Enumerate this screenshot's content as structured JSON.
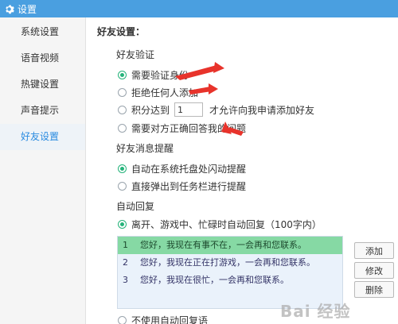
{
  "window": {
    "title": "设置",
    "accent_color": "#4a9fe0"
  },
  "sidebar": {
    "items": [
      {
        "label": "系统设置"
      },
      {
        "label": "语音视频"
      },
      {
        "label": "热键设置"
      },
      {
        "label": "声音提示"
      },
      {
        "label": "好友设置"
      }
    ],
    "active_index": 4
  },
  "main": {
    "title": "好友设置：",
    "verification": {
      "label": "好友验证",
      "options": [
        {
          "label": "需要验证身份",
          "selected": true
        },
        {
          "label": "拒绝任何人添加",
          "selected": false
        },
        {
          "label_prefix": "积分达到",
          "value": "1",
          "label_suffix": "才允许向我申请添加好友",
          "selected": false
        },
        {
          "label": "需要对方正确回答我的问题",
          "selected": false
        }
      ]
    },
    "reminder": {
      "label": "好友消息提醒",
      "options": [
        {
          "label": "自动在系统托盘处闪动提醒",
          "selected": true
        },
        {
          "label": "直接弹出到任务栏进行提醒",
          "selected": false
        }
      ]
    },
    "auto_reply": {
      "label": "自动回复",
      "option_on": {
        "label": "离开、游戏中、忙碌时自动回复（100字内）",
        "selected": true
      },
      "replies": [
        {
          "num": "1",
          "text": "您好，我现在有事不在，一会再和您联系。",
          "selected": true
        },
        {
          "num": "2",
          "text": "您好，我现在正在打游戏，一会再和您联系。",
          "selected": false
        },
        {
          "num": "3",
          "text": "您好，我现在很忙，一会再和您联系。",
          "selected": false
        }
      ],
      "buttons": {
        "add": "添加",
        "edit": "修改",
        "delete": "删除"
      },
      "option_off": {
        "label": "不使用自动回复语",
        "selected": false
      }
    }
  },
  "watermark": "Bai 经验"
}
